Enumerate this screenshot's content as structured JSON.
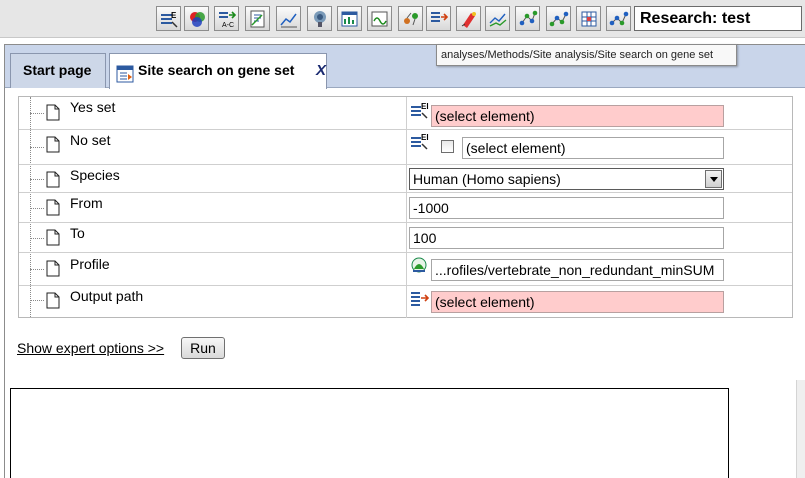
{
  "toolbar": {
    "buttons": [
      {
        "icon": "gene-set-icon"
      },
      {
        "icon": "venn-diagram-icon"
      },
      {
        "icon": "convert-table-icon"
      },
      {
        "icon": "sequence-analysis-icon"
      },
      {
        "icon": "expression-chart-icon"
      },
      {
        "icon": "gene-ontology-icon"
      },
      {
        "icon": "site-search-icon"
      },
      {
        "icon": "profile-icon"
      },
      {
        "icon": "cluster-analysis-icon"
      },
      {
        "icon": "table-export-icon"
      },
      {
        "icon": "marker-icon"
      },
      {
        "icon": "compare-chart-icon"
      },
      {
        "icon": "network-icon"
      },
      {
        "icon": "network-alt-icon"
      },
      {
        "icon": "grid-table-icon"
      },
      {
        "icon": "pathway-icon"
      }
    ],
    "research_label": "Research: test"
  },
  "tabs": {
    "start": "Start page",
    "active": "Site search on gene set",
    "close": "X"
  },
  "tooltip": "analyses/Methods/Site analysis/Site search on gene set",
  "properties": [
    {
      "label": "Yes set",
      "value": "(select element)",
      "kind": "element-select",
      "state": "required-empty"
    },
    {
      "label": "No set",
      "value": "(select element)",
      "kind": "element-select-with-checkbox",
      "state": "optional"
    },
    {
      "label": "Species",
      "value": "Human (Homo sapiens)",
      "kind": "dropdown"
    },
    {
      "label": "From",
      "value": "-1000",
      "kind": "text"
    },
    {
      "label": "To",
      "value": "100",
      "kind": "text"
    },
    {
      "label": "Profile",
      "value": "...rofiles/vertebrate_non_redundant_minSUM",
      "kind": "profile-path"
    },
    {
      "label": "Output path",
      "value": "(select element)",
      "kind": "element-select",
      "state": "required-empty"
    }
  ],
  "actions": {
    "expert_link": "Show expert options >>",
    "run": "Run"
  },
  "colors": {
    "required_field": "#ffcccc",
    "tab_strip": "#c9d5ea",
    "toolbar": "#e6e6e6"
  }
}
